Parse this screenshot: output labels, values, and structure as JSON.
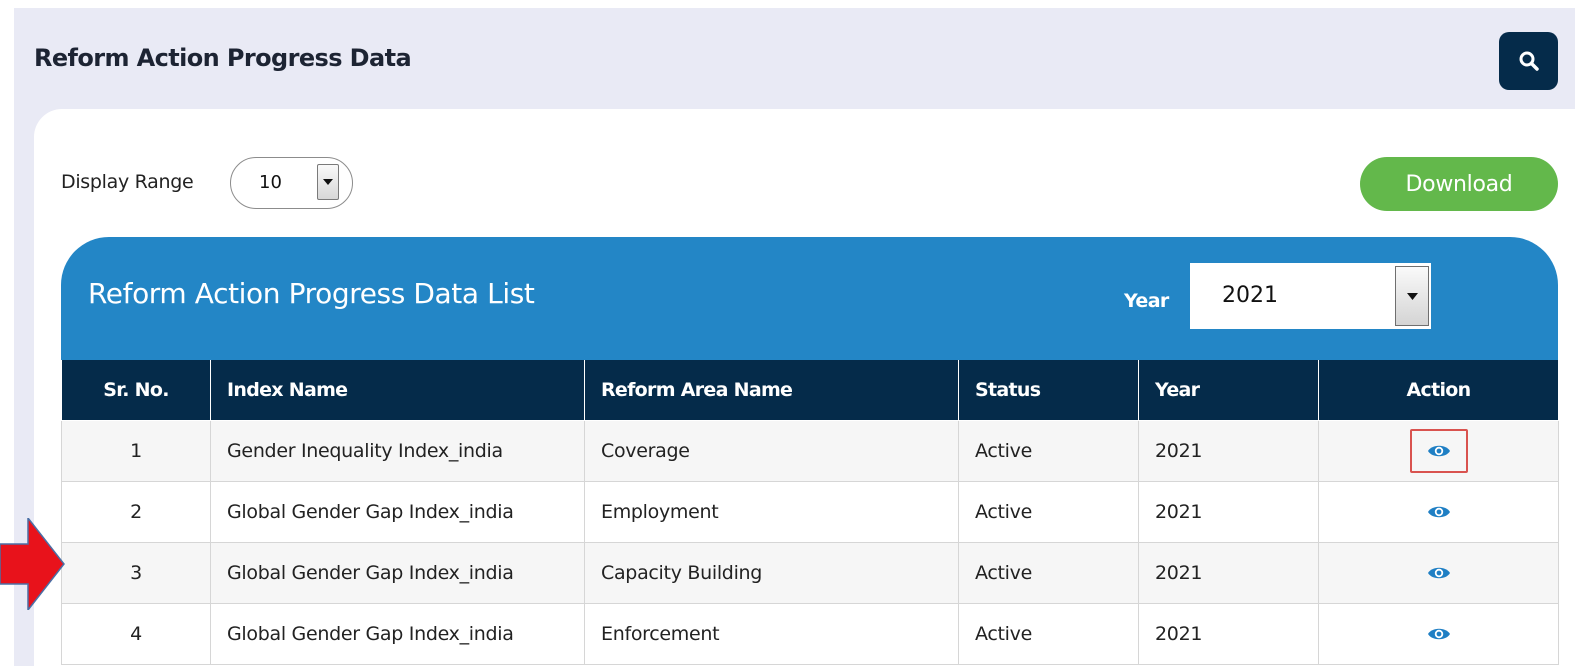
{
  "page": {
    "title": "Reform Action Progress Data"
  },
  "toolbar": {
    "display_range_label": "Display Range",
    "display_range_value": "10",
    "download_label": "Download"
  },
  "list": {
    "title": "Reform Action Progress Data List",
    "year_label": "Year",
    "year_value": "2021"
  },
  "table": {
    "headers": [
      "Sr. No.",
      "Index Name",
      "Reform Area Name",
      "Status",
      "Year",
      "Action"
    ],
    "rows": [
      {
        "sr": "1",
        "index": "Gender Inequality Index_india",
        "area": "Coverage",
        "status": "Active",
        "year": "2021"
      },
      {
        "sr": "2",
        "index": "Global Gender Gap Index_india",
        "area": "Employment",
        "status": "Active",
        "year": "2021"
      },
      {
        "sr": "3",
        "index": "Global Gender Gap Index_india",
        "area": "Capacity Building",
        "status": "Active",
        "year": "2021"
      },
      {
        "sr": "4",
        "index": "Global Gender Gap Index_india",
        "area": "Enforcement",
        "status": "Active",
        "year": "2021"
      }
    ]
  },
  "icons": {
    "search": "search-icon",
    "view": "eye-icon",
    "dropdown": "caret-down-icon",
    "annotation": "red-arrow-icon"
  },
  "colors": {
    "navy": "#052b4a",
    "header_blue": "#2386c6",
    "download_green": "#63b84b",
    "eye_blue": "#1f7fc4",
    "highlight_red": "#d9534f",
    "arrow_red": "#e8121b"
  }
}
